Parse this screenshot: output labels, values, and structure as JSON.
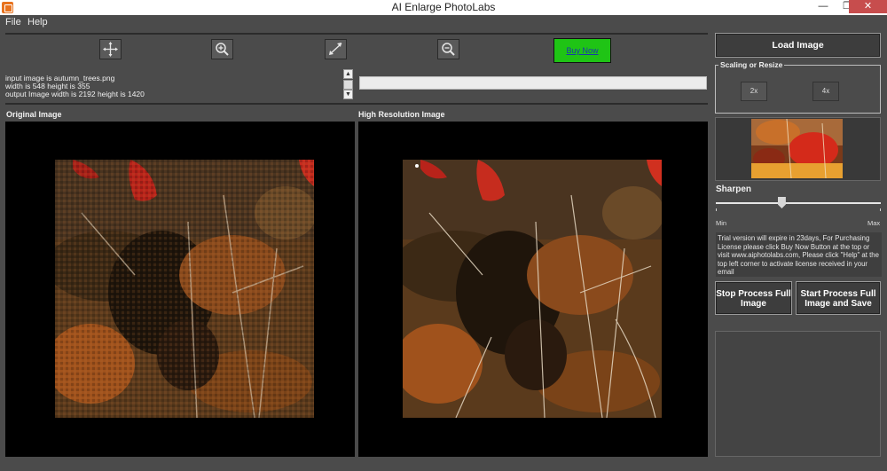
{
  "window": {
    "title": "AI Enlarge PhotoLabs",
    "min_glyph": "—",
    "max_glyph": "❐",
    "close_glyph": "✕"
  },
  "menu": {
    "items": [
      "File",
      "Help"
    ]
  },
  "toolbar": {
    "tools": [
      "move-icon",
      "zoom-in-icon",
      "fit-screen-icon",
      "zoom-out-icon"
    ],
    "buy_now_label": "Buy Now",
    "buy_now_color": "#1fc415"
  },
  "log": {
    "lines": [
      "input image is autumn_trees.png",
      "width is 548 height is 355",
      "output Image width is 2192 height is 1420"
    ],
    "scroll_up": "▲",
    "scroll_down": "▼"
  },
  "panels": {
    "original_title": "Original Image",
    "high_res_title": "High Resolution Image"
  },
  "sidebar": {
    "load_image_label": "Load Image",
    "scaling_label": "Scaling or Resize",
    "scale_2x_label": "2x",
    "scale_4x_label": "4x",
    "sharpen_label": "Sharpen",
    "sharpen_value": 0.4,
    "min_label": "Min",
    "max_label": "Max",
    "trial_text": "Trial version will expire in 23days, For Purchasing License please click Buy Now Button at the top or visit www.aiphotolabs.com, Please click \"Help\" at the top left corner to activate license received in your email",
    "stop_label": "Stop Process Full Image",
    "start_label": "Start Process Full Image and Save"
  }
}
